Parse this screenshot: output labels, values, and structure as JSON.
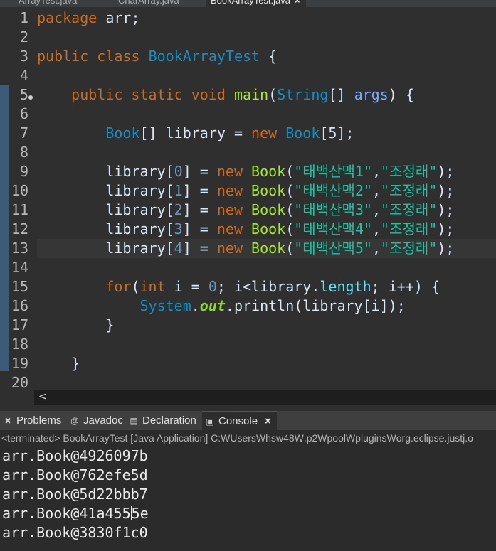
{
  "editor_tabs": [
    {
      "label": "ArrayTest.java",
      "active": false
    },
    {
      "label": "CharArray.java",
      "active": false
    },
    {
      "label": "BookArrayTest.java",
      "active": true
    }
  ],
  "editor_tab_close": "×",
  "line_numbers": [
    "1",
    "2",
    "3",
    "4",
    "5",
    "6",
    "7",
    "8",
    "9",
    "10",
    "11",
    "12",
    "13",
    "14",
    "15",
    "16",
    "17",
    "18",
    "19",
    "20"
  ],
  "code": {
    "l1": {
      "kw": "package",
      "rest": " arr;"
    },
    "l3": {
      "kw1": "public",
      "kw2": "class",
      "cls": "BookArrayTest",
      "rest": " {"
    },
    "l5": {
      "kw1": "public",
      "kw2": "static",
      "kw3": "void",
      "method": "main",
      "p1": "(",
      "type": "String",
      "p2": "[] ",
      "param": "args",
      "p3": ") {"
    },
    "l7": {
      "type1": "Book",
      "p1": "[] library = ",
      "kw": "new",
      "type2": "Book",
      "p2": "[5];"
    },
    "book_lines": [
      {
        "pre": "library[",
        "idx": "0",
        "mid": "] = ",
        "kw": "new",
        "type": "Book",
        "p1": "(",
        "s1": "\"태백산맥1\"",
        "c": ",",
        "s2": "\"조정래\"",
        "end": ");"
      },
      {
        "pre": "library[",
        "idx": "1",
        "mid": "] = ",
        "kw": "new",
        "type": "Book",
        "p1": "(",
        "s1": "\"태백산맥2\"",
        "c": ",",
        "s2": "\"조정래\"",
        "end": ");"
      },
      {
        "pre": "library[",
        "idx": "2",
        "mid": "] = ",
        "kw": "new",
        "type": "Book",
        "p1": "(",
        "s1": "\"태백산맥3\"",
        "c": ",",
        "s2": "\"조정래\"",
        "end": ");"
      },
      {
        "pre": "library[",
        "idx": "3",
        "mid": "] = ",
        "kw": "new",
        "type": "Book",
        "p1": "(",
        "s1": "\"태백산맥4\"",
        "c": ",",
        "s2": "\"조정래\"",
        "end": ");"
      },
      {
        "pre": "library[",
        "idx": "4",
        "mid": "] = ",
        "kw": "new",
        "type": "Book",
        "p1": "(",
        "s1": "\"태백산맥5\"",
        "c": ",",
        "s2": "\"조정래\"",
        "end": ");"
      }
    ],
    "l15": {
      "kw": "for",
      "p1": "(",
      "kw2": "int",
      "p2": " i = ",
      "num": "0",
      "p3": "; i<library.",
      "field": "length",
      "p4": "; i++) {"
    },
    "l16": {
      "type": "System",
      "dot": ".",
      "sfield": "out",
      "p1": ".println(library[i]);"
    },
    "l17": "}",
    "l19": "}"
  },
  "hscroll_arrow": "<",
  "views": [
    {
      "label": "Problems",
      "icon": "problems-icon",
      "glyph": "✖"
    },
    {
      "label": "Javadoc",
      "icon": "javadoc-icon",
      "glyph": "@"
    },
    {
      "label": "Declaration",
      "icon": "declaration-icon",
      "glyph": "▤"
    },
    {
      "label": "Console",
      "icon": "console-icon",
      "glyph": "▣",
      "active": true
    }
  ],
  "views_close": "×",
  "console": {
    "status": "<terminated> BookArrayTest [Java Application] C:₩Users₩hsw48₩.p2₩pool₩plugins₩org.eclipse.justj.o",
    "lines": [
      "arr.Book@4926097b",
      "arr.Book@762efe5d",
      "arr.Book@5d22bbb7",
      "arr.Book@41a4555e",
      "arr.Book@3830f1c0"
    ],
    "line4_before_caret": "arr.Book@41a455",
    "line4_after_caret": "5e"
  },
  "colors": {
    "keyword": "#cc6c1d",
    "type": "#1290c3",
    "method": "#a7ec21",
    "string": "#17c6a3",
    "number": "#6897bb",
    "field": "#66e1f8",
    "editor_bg": "#2f2f2f",
    "ruler": "#3d5a78"
  }
}
